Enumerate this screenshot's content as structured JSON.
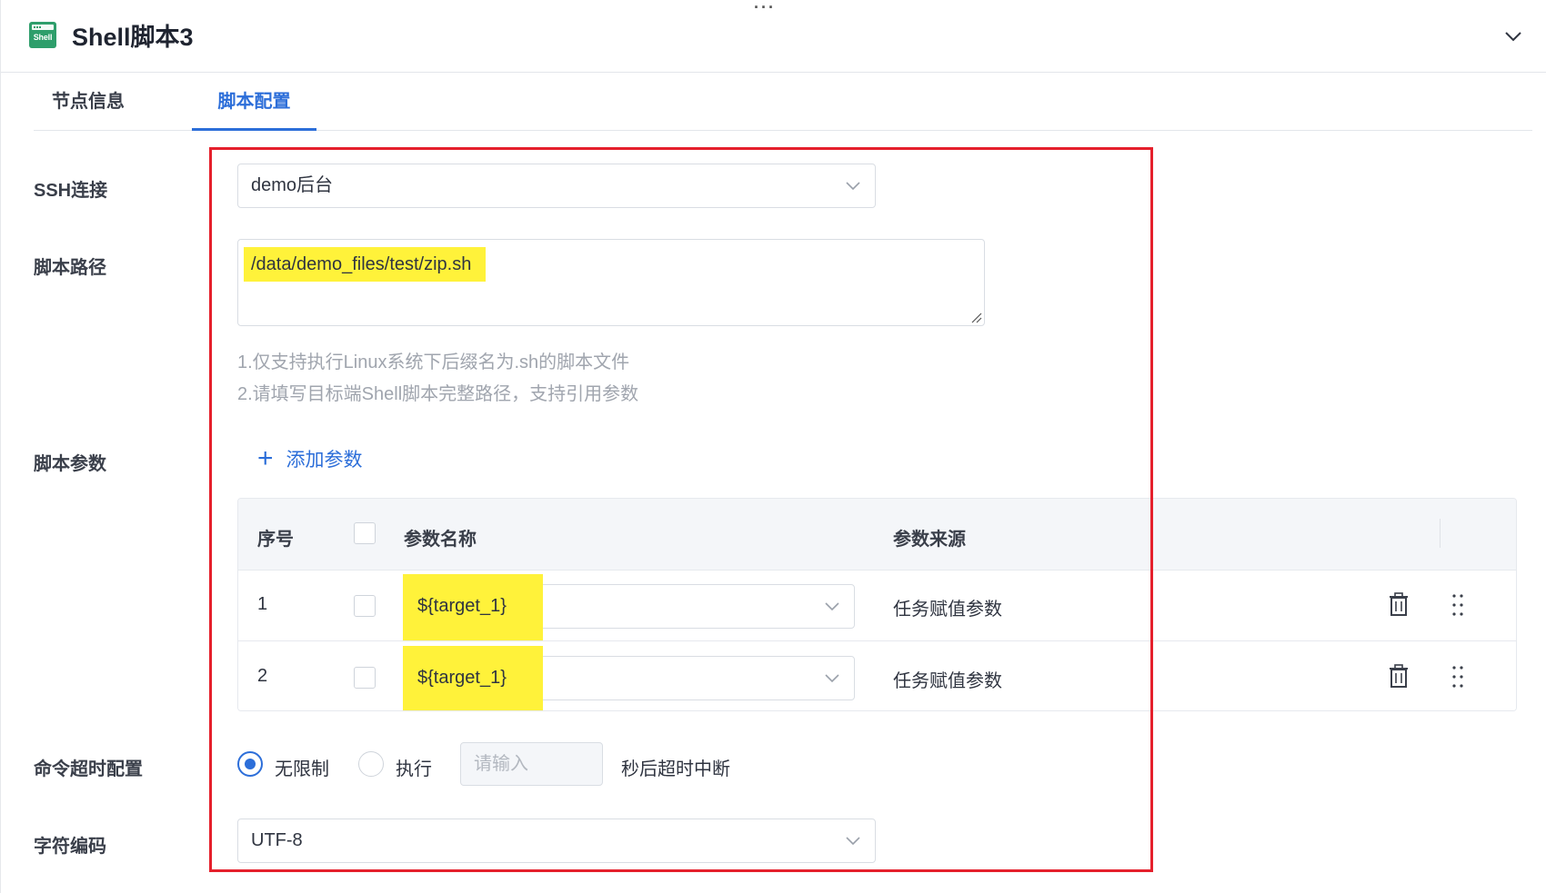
{
  "header": {
    "drag_handle": "···",
    "icon_text": "Shell",
    "title": "Shell脚本3"
  },
  "tabs": [
    {
      "label": "节点信息",
      "active": false
    },
    {
      "label": "脚本配置",
      "active": true
    }
  ],
  "form": {
    "ssh": {
      "label": "SSH连接",
      "value": "demo后台"
    },
    "script_path": {
      "label": "脚本路径",
      "value": "/data/demo_files/test/zip.sh",
      "hints": [
        "1.仅支持执行Linux系统下后缀名为.sh的脚本文件",
        "2.请填写目标端Shell脚本完整路径，支持引用参数"
      ]
    },
    "script_params": {
      "label": "脚本参数",
      "add_label": "添加参数",
      "columns": [
        "序号",
        "参数名称",
        "参数来源"
      ],
      "rows": [
        {
          "index": "1",
          "name": "${target_1}",
          "source": "任务赋值参数"
        },
        {
          "index": "2",
          "name": "${target_1}",
          "source": "任务赋值参数"
        }
      ]
    },
    "timeout": {
      "label": "命令超时配置",
      "option_unlimited": "无限制",
      "option_execute": "执行",
      "input_placeholder": "请输入",
      "suffix": "秒后超时中断",
      "selected": "无限制"
    },
    "encoding": {
      "label": "字符编码",
      "value": "UTF-8"
    }
  },
  "colors": {
    "accent": "#2c6ed9",
    "highlight": "#fff23a",
    "annotation_border": "#e5202c",
    "icon_green": "#2e9e6b"
  }
}
